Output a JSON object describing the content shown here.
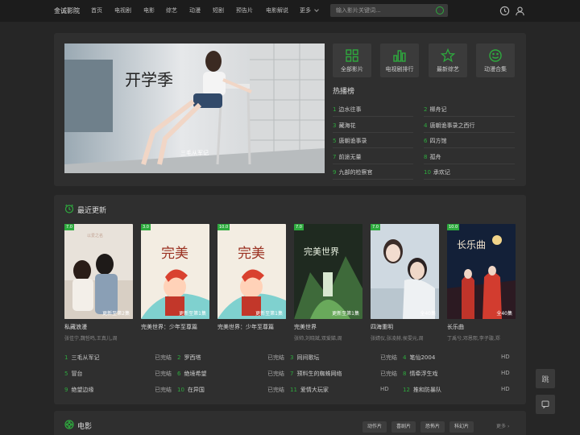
{
  "header": {
    "logo": "金诚影院",
    "nav": [
      "首页",
      "电视剧",
      "电影",
      "综艺",
      "动漫",
      "短剧",
      "预告片",
      "电影解说",
      "更多"
    ],
    "search_placeholder": "输入影片关键词..."
  },
  "banner": {
    "caption": "三毛从军记",
    "poster_text": "开学季"
  },
  "quick": [
    "全部影片",
    "电视剧排行",
    "最新综艺",
    "动漫合集"
  ],
  "hot": {
    "title": "热播榜",
    "items": [
      {
        "n": "1",
        "t": "边水往事"
      },
      {
        "n": "2",
        "t": "柳舟记"
      },
      {
        "n": "3",
        "t": "藏海花"
      },
      {
        "n": "4",
        "t": "唐朝诡事录之西行"
      },
      {
        "n": "5",
        "t": "唐朝诡事录"
      },
      {
        "n": "6",
        "t": "四方馆"
      },
      {
        "n": "7",
        "t": "前途无量"
      },
      {
        "n": "8",
        "t": "孤舟"
      },
      {
        "n": "9",
        "t": "九部的检察官"
      },
      {
        "n": "10",
        "t": "承欢记"
      }
    ]
  },
  "recent": {
    "title": "最近更新",
    "posters": [
      {
        "rate": "7.0",
        "ep": "更新至第2集",
        "title": "私藏浪漫",
        "cast": "张佳宁,魏哲鸣,王真儿,周"
      },
      {
        "rate": "3.0",
        "ep": "更新至第1集",
        "title": "完美世界：少年至尊篇",
        "cast": ""
      },
      {
        "rate": "10.0",
        "ep": "更新至第1集",
        "title": "完美世界：少年至尊篇",
        "cast": ""
      },
      {
        "rate": "7.0",
        "ep": "更新至第1集",
        "title": "完美世界",
        "cast": "张帅,刘晓斌,双爱娣,周"
      },
      {
        "rate": "7.0",
        "ep": "全40集",
        "title": "四海重明",
        "cast": "张婧仪,张凌赫,侯雯元,周"
      },
      {
        "rate": "10.0",
        "ep": "全40集",
        "title": "长乐曲",
        "cast": "丁禹兮,邓恩熙,李子璇,郑"
      }
    ],
    "rows": [
      {
        "n": "1",
        "t": "三毛从军记",
        "s": "已完结"
      },
      {
        "n": "2",
        "t": "罗西塔",
        "s": "已完结"
      },
      {
        "n": "3",
        "t": "同间歌坛",
        "s": "已完结"
      },
      {
        "n": "4",
        "t": "笔仙2004",
        "s": "HD"
      },
      {
        "n": "5",
        "t": "冒台",
        "s": "已完结"
      },
      {
        "n": "6",
        "t": "绝境希望",
        "s": "已完结"
      },
      {
        "n": "7",
        "t": "预料生的蜘蛛网络",
        "s": "已完结"
      },
      {
        "n": "8",
        "t": "情牵浮生戏",
        "s": "HD"
      },
      {
        "n": "9",
        "t": "绝望边缘",
        "s": "已完结"
      },
      {
        "n": "10",
        "t": "在异国",
        "s": "已完结"
      },
      {
        "n": "11",
        "t": "爱情大玩家",
        "s": "HD"
      },
      {
        "n": "12",
        "t": "推和防暴队",
        "s": "HD"
      }
    ]
  },
  "movies": {
    "title": "电影",
    "tags": [
      "动作片",
      "喜剧片",
      "恐怖片",
      "科幻片"
    ],
    "more": "更多"
  },
  "side": {
    "float1": "跳"
  },
  "colors": {
    "accent": "#2eaa3e",
    "bg": "#262626",
    "panel": "#2f2f2f",
    "top": "#1c1c1c"
  }
}
